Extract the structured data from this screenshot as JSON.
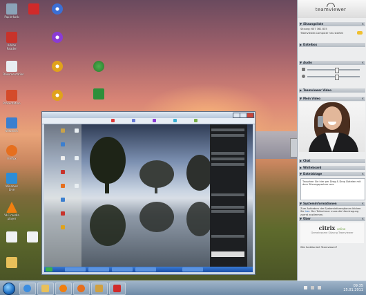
{
  "teamviewer": {
    "logo_text": "teamviewer",
    "sections": {
      "session_list": "Sitzungsliste",
      "file_box": "Dateibox",
      "audio": "Audio",
      "video": "Teamviewer Video",
      "my_video": "Mein Video",
      "chat": "Chat",
      "whiteboard": "Whiteboard",
      "file_transfer": "Dateiablage",
      "system_info": "Systeminformationen",
      "about": "Über"
    },
    "session_id_line": "Sitzung: 607 361 835",
    "computer_line": "Teamviewer-Computer neu starten",
    "file_text": "Tauschen Sie hier per Drag & Drop Dateien mit dem Sitzungspartner aus.",
    "sysinfo_text_1": "Zum Anfordern der Systeminformationen klicken Sie",
    "sysinfo_link": "hier",
    "sysinfo_text_2": "Der Teilnehmer muss die Übertragung zuerst zustimmen.",
    "citrix_logo": "citrix",
    "citrix_sub": "online",
    "about_text": "Gemeinsame Sitzung Teamviewer",
    "network_line": "Wie funktioniert Teamviewer?"
  },
  "desktop_icons": [
    {
      "label": "Papierkorb",
      "color": "#8ba3b8"
    },
    {
      "label": "Adobe Reader",
      "color": "#c8332b"
    },
    {
      "label": "Dokumentation",
      "color": "#e8eef2"
    },
    {
      "label": "Firefox",
      "color": "#e66f1e"
    },
    {
      "label": "VLC media player",
      "color": "#f07f10"
    },
    {
      "label": "Netzwerk",
      "color": "#3b7fcf"
    },
    {
      "label": "Präsentation",
      "color": "#d44b2b"
    },
    {
      "label": "Windows Live",
      "color": "#2d8dd6"
    }
  ],
  "taskbar": {
    "time": "09:35",
    "date": "25.01.2011"
  },
  "colors": {
    "teamviewer_section": "#b5bcc4",
    "taskbar": "#6e8aa6",
    "remote_taskbar": "#1b4fa7"
  }
}
